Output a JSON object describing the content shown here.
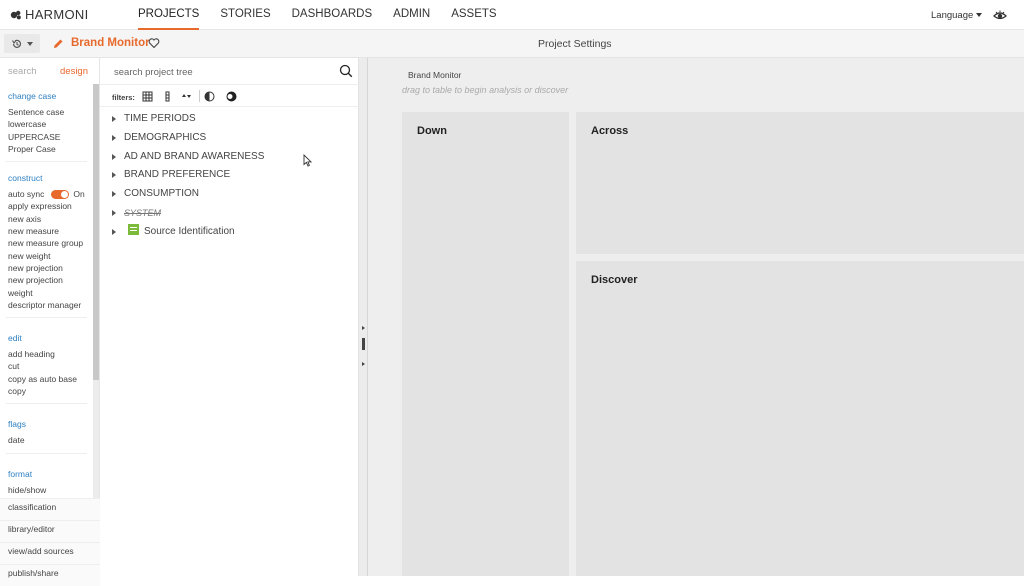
{
  "app": {
    "brand": "HARMONI"
  },
  "nav": {
    "items": [
      {
        "label": "PROJECTS",
        "active": true
      },
      {
        "label": "STORIES",
        "active": false
      },
      {
        "label": "DASHBOARDS",
        "active": false
      },
      {
        "label": "ADMIN",
        "active": false
      },
      {
        "label": "ASSETS",
        "active": false
      }
    ],
    "language_label": "Language"
  },
  "subbar": {
    "project_name": "Brand Monitor",
    "page_title": "Project Settings"
  },
  "left_panel": {
    "tabs": [
      "search",
      "design"
    ],
    "active_tab": "design",
    "sections": {
      "change_case": {
        "title": "change case",
        "items": [
          "Sentence case",
          "lowercase",
          "UPPERCASE",
          "Proper Case"
        ]
      },
      "construct": {
        "title": "construct",
        "auto_sync_label": "auto sync",
        "auto_sync_state": "On",
        "items": [
          "apply expression",
          "new axis",
          "new measure",
          "new measure group",
          "new weight",
          "new projection",
          "new projection",
          "weight",
          "descriptor manager"
        ]
      },
      "edit": {
        "title": "edit",
        "items": [
          "add heading",
          "cut",
          "copy as auto base",
          "copy"
        ]
      },
      "flags": {
        "title": "flags",
        "items": [
          "date"
        ]
      },
      "format": {
        "title": "format",
        "items": [
          "hide/show"
        ]
      }
    },
    "bottom_items": [
      "classification",
      "library/editor",
      "view/add sources",
      "publish/share"
    ]
  },
  "tree": {
    "search_placeholder": "search project tree",
    "filters_label": "filters:",
    "items": [
      {
        "label": "TIME PERIODS"
      },
      {
        "label": "DEMOGRAPHICS"
      },
      {
        "label": "AD AND BRAND AWARENESS"
      },
      {
        "label": "BRAND PREFERENCE"
      },
      {
        "label": "CONSUMPTION"
      },
      {
        "label": "SYSTEM"
      },
      {
        "label": "Source Identification"
      }
    ]
  },
  "workspace": {
    "title": "Brand Monitor",
    "hint": "drag to table to begin analysis or discover",
    "zones": {
      "down": "Down",
      "across": "Across",
      "discover": "Discover"
    }
  },
  "colors": {
    "accent": "#e8692c",
    "link": "#2d7fc1",
    "source_icon": "#7cba3a"
  }
}
